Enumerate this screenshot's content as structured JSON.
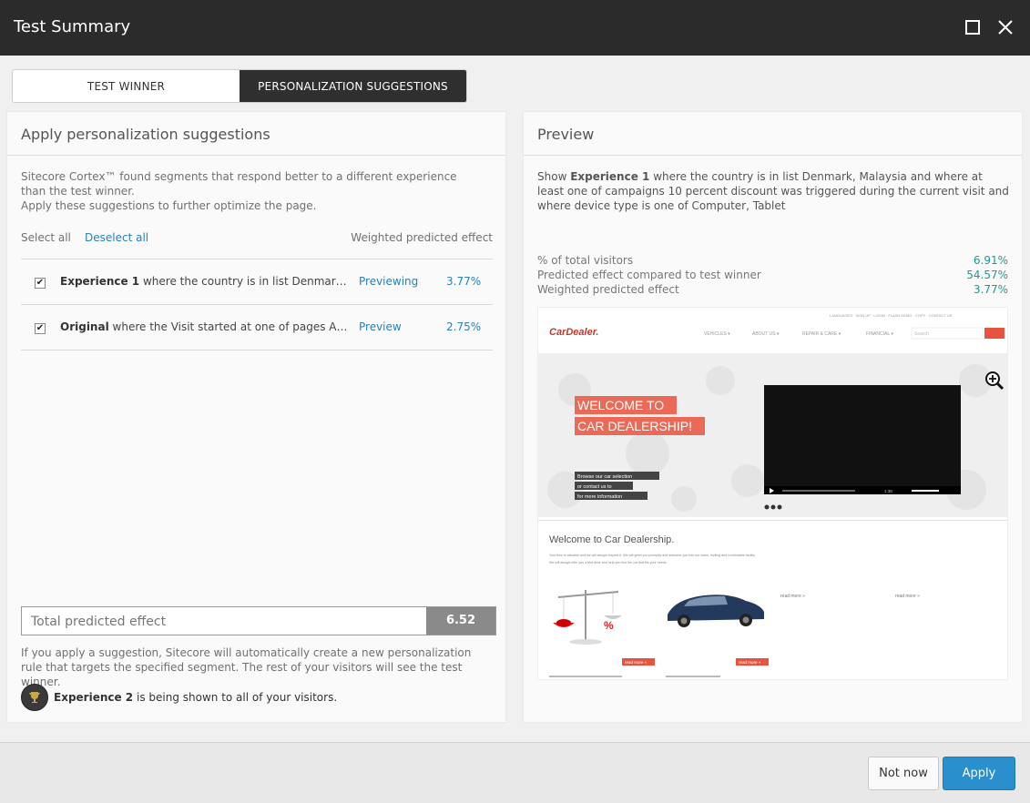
{
  "window": {
    "title": "Test Summary"
  },
  "tabs": [
    {
      "label": "TEST WINNER",
      "active": false
    },
    {
      "label": "PERSONALIZATION SUGGESTIONS",
      "active": true
    }
  ],
  "left": {
    "heading": "Apply personalization suggestions",
    "intro_line1": "Sitecore Cortex™ found segments that respond better to a different experience than the test winner.",
    "intro_line2": "Apply these suggestions to further optimize the page.",
    "select_all": "Select all",
    "deselect_all": "Deselect all",
    "weighted_header": "Weighted predicted effect",
    "items": [
      {
        "name": "Experience 1",
        "text": " where the country is in list Denmark, Malaysia and where at least one of campaigns 10 percent discount was triggered",
        "action": "Previewing",
        "pct": "3.77%",
        "checked": true
      },
      {
        "name": "Original",
        "text": " where the Visit started at one of pages About Us",
        "action": "Preview",
        "pct": "2.75%",
        "checked": true
      }
    ],
    "total_label": "Total predicted effect",
    "total_value": "6.52",
    "footnote": "If you apply a suggestion, Sitecore will automatically create a new personalization rule that targets the specified segment. The rest of your visitors will see the test winner.",
    "shown_name": "Experience 2",
    "shown_text": " is being shown to all of your visitors."
  },
  "right": {
    "heading": "Preview",
    "desc_pre": "Show ",
    "desc_bold": "Experience 1",
    "desc_post": " where the country is in list Denmark, Malaysia and where at least one of campaigns 10 percent discount was triggered during the current visit and where device type is one of Computer, Tablet",
    "stats": [
      {
        "label": "% of total visitors",
        "value": "6.91%"
      },
      {
        "label": "Predicted effect compared to test winner",
        "value": "54.57%"
      },
      {
        "label": "Weighted predicted effect",
        "value": "3.77%"
      }
    ],
    "site": {
      "logo": "CarDealer.",
      "top_links": "LANGUAGES · SIGN UP · LOGIN · FLASH DEMO · COPY · CONTACT US",
      "nav": [
        "VEHICLES ▾",
        "ABOUT US ▾",
        "REPAIR & CARE ▾",
        "FINANCIAL ▾"
      ],
      "search_placeholder": "Search",
      "hero_line1": "WELCOME TO",
      "hero_line2": "CAR DEALERSHIP!",
      "cta1": "Browse our car selection",
      "cta2": "or contact us to",
      "cta3": "for more information",
      "video_time": "1:38",
      "welcome_title": "Welcome to Car Dealership.",
      "welcome_text1": "Your time is valuable and we will always respect it. We will greet you promptly and welcome you into our warm, inviting and comfortable facility.",
      "welcome_text2": "We will always offer you a test drive and help you find the car that fits your needs.",
      "read_more": "read more »",
      "sale_mark": "%"
    }
  },
  "footer": {
    "not_now": "Not now",
    "apply": "Apply"
  },
  "colors": {
    "accent": "#2a8fcd",
    "link": "#2a7fb8",
    "stat": "#1e9b8f",
    "titlebar": "#2b2b2b"
  }
}
